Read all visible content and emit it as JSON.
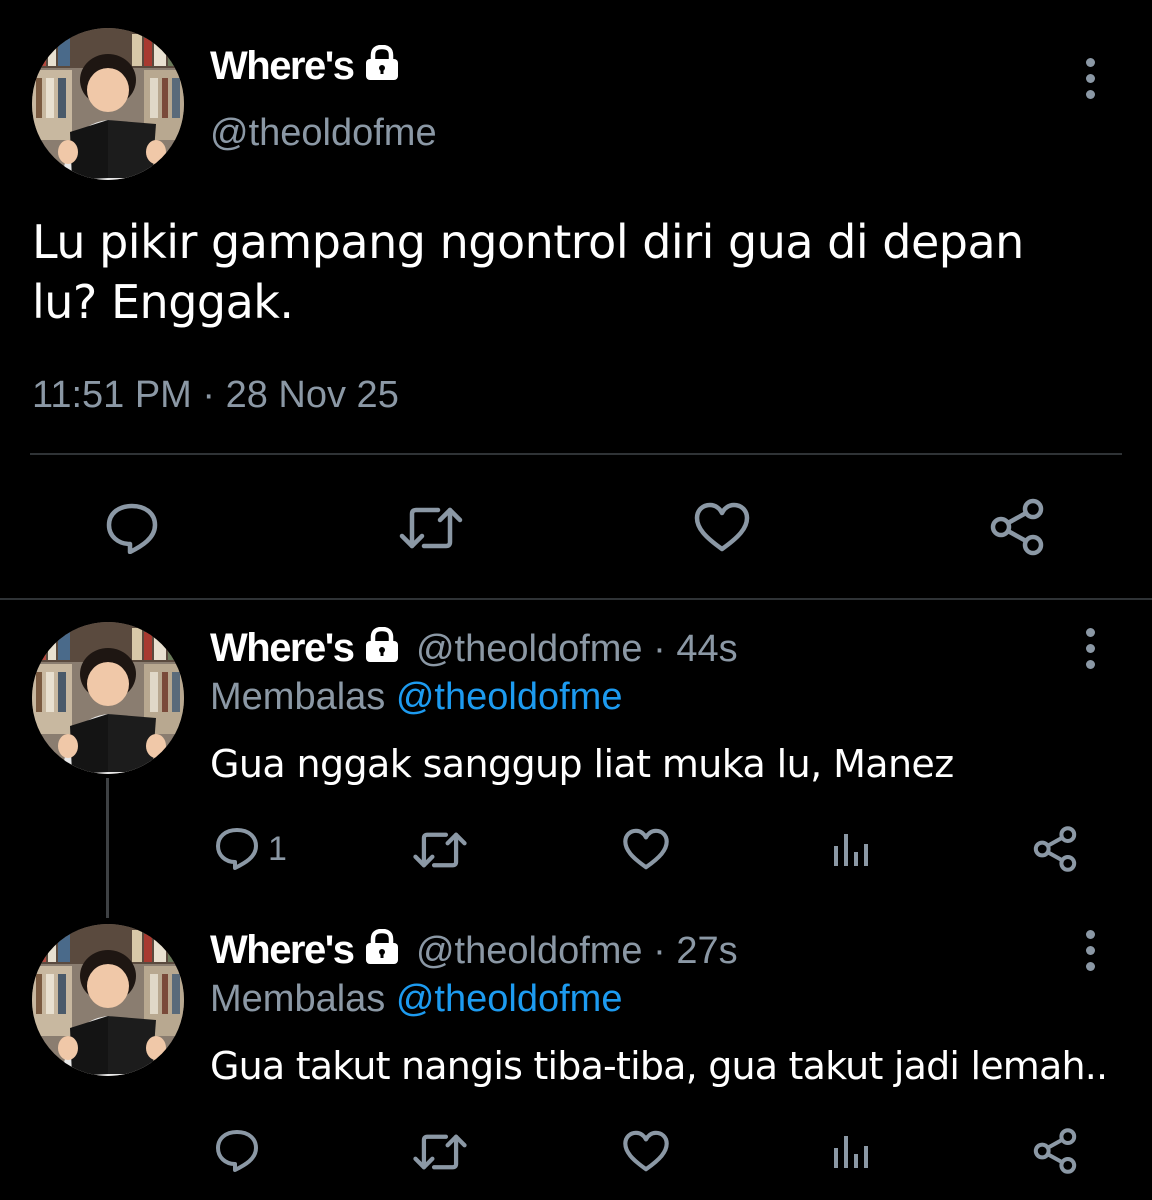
{
  "main_tweet": {
    "display_name": "Where's",
    "handle": "@theoldofme",
    "text_line1": "Lu pikir gampang ngontrol diri gua di depan",
    "text_line2": "lu? Enggak.",
    "timestamp": "11:51 PM · 28 Nov 25"
  },
  "replies": [
    {
      "display_name": "Where's",
      "handle_time": "@theoldofme · 44s",
      "replying_label": "Membalas",
      "replying_to": "@theoldofme",
      "text": "Gua nggak sanggup liat muka lu, Manez",
      "reply_count": "1"
    },
    {
      "display_name": "Where's",
      "handle_time": "@theoldofme · 27s",
      "replying_label": "Membalas",
      "replying_to": "@theoldofme",
      "text": "Gua takut nangis tiba-tiba, gua takut jadi lemah..",
      "reply_count": ""
    }
  ],
  "icons": {
    "reply": "speech-bubble-icon",
    "retweet": "retweet-arrows-icon",
    "like": "heart-icon",
    "analytics": "bar-chart-icon",
    "share": "share-nodes-icon",
    "more": "vertical-dots-icon",
    "lock": "padlock-icon"
  },
  "colors": {
    "background": "#000000",
    "muted": "#8b98a5",
    "link": "#1d9bf0",
    "separator": "#2f3336"
  }
}
